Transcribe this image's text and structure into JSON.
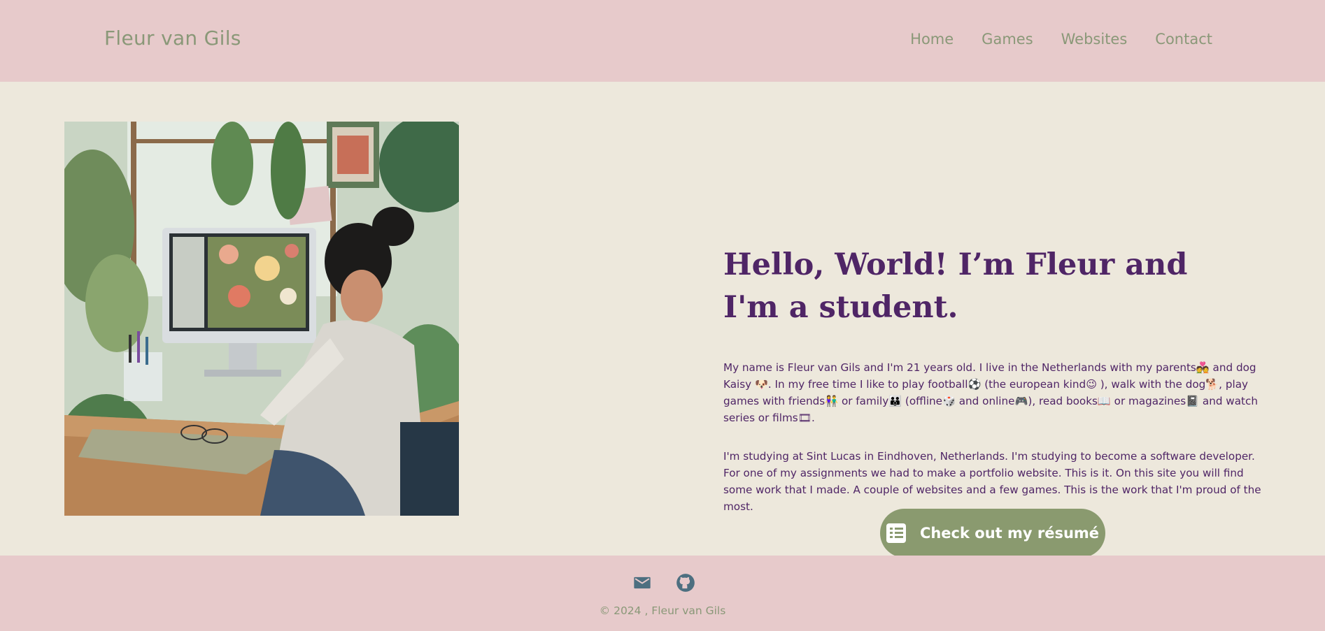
{
  "header": {
    "brand": "Fleur van Gils",
    "nav": [
      "Home",
      "Games",
      "Websites",
      "Contact"
    ]
  },
  "hero": {
    "title": "Hello, World! I’m Fleur and I'm a student.",
    "paragraph1": "My name is Fleur van Gils and I'm 21 years old. I live in the Netherlands with my parents💑 and dog Kaisy 🐶. In my free time I like to play football⚽ (the european kind😉 ), walk with the dog🐕, play games with friends👫 or family👪 (offline🎲 and online🎮), read books📖 or magazines📓 and watch series or films🎞.",
    "paragraph2": "I'm studying at Sint Lucas in Eindhoven, Netherlands. I'm studying to become a software developer. For one of my assignments we had to make a portfolio website. This is it. On this site you will find some work that I made. A couple of websites and a few games. This is the work that I'm proud of the most.",
    "button": "Check out my résumé",
    "button_icon": "list-icon"
  },
  "footer": {
    "icons": [
      "mail-icon",
      "github-icon"
    ],
    "copyright": "© 2024 , Fleur van Gils"
  },
  "colors": {
    "header_bg": "#e7cacb",
    "page_bg": "#ede8dc",
    "accent_green": "#8a9a6f",
    "text_purple": "#4f2566",
    "nav_text": "#8a9878",
    "icon_slate": "#4d6f80"
  }
}
